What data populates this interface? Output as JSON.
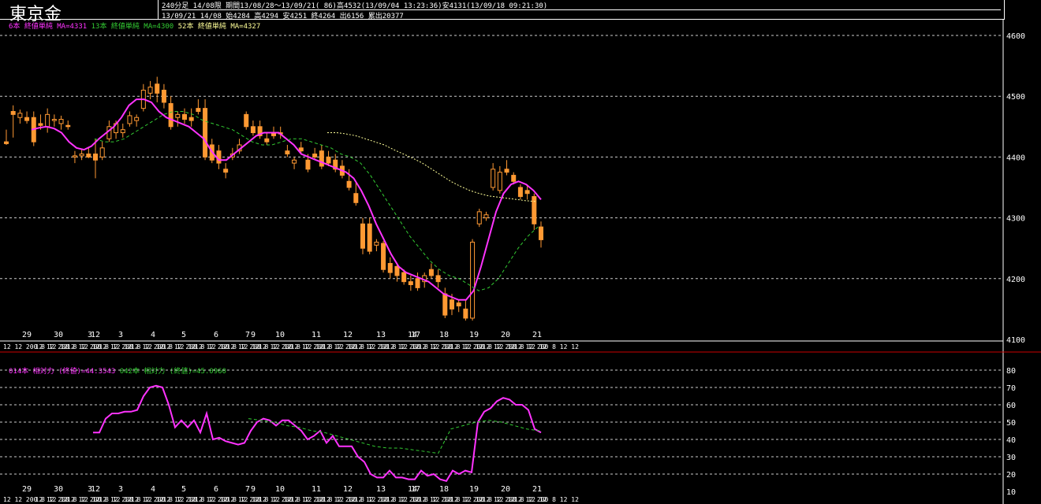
{
  "header": {
    "title": "東京金",
    "line1": "240分足 14/08限 期間13/08/28～13/09/21( 86)高4532(13/09/04 13:23:36)安4131(13/09/18 09:21:30)",
    "line2": "13/09/21 14/08 始4284 高4294 安4251 終4264 出6156 累出20377"
  },
  "legend_main": [
    {
      "text": "6本 終値単純 MA=4331",
      "color": "#ff33ff"
    },
    {
      "text": "13本 終値単純 MA=4300",
      "color": "#33cc33"
    },
    {
      "text": "52本 終値単純 MA=4327",
      "color": "#ffff99"
    }
  ],
  "legend_sub": [
    {
      "text": "014本 相対力 (終値)=44.3543",
      "color": "#ff33ff"
    },
    {
      "text": "042本 相対力 (終値)=45.0960",
      "color": "#33cc33"
    }
  ],
  "colors": {
    "up": "#ff9933",
    "down": "#ff9933",
    "ma6": "#ff33ff",
    "ma13": "#33cc33",
    "ma52": "#ffff99",
    "grid": "#ffffff",
    "separator": "#cc0000"
  },
  "chart_data": [
    {
      "type": "candlestick",
      "title": "東京金",
      "ylim": [
        4100,
        4600
      ],
      "y_ticks": [
        4100,
        4200,
        4300,
        4400,
        4500,
        4600
      ],
      "date_labels": [
        "29",
        "30",
        "3",
        "12",
        "3",
        "4",
        "5",
        "6",
        "7",
        "9",
        "10",
        "11",
        "12",
        "13",
        "14",
        "17",
        "18",
        "19",
        "20",
        "21"
      ],
      "time_label": "12 12 200 8 12 12",
      "candles": [
        {
          "o": 4425,
          "h": 4445,
          "l": 4420,
          "c": 4422
        },
        {
          "o": 4475,
          "h": 4485,
          "l": 4432,
          "c": 4470
        },
        {
          "o": 4465,
          "h": 4478,
          "l": 4455,
          "c": 4472
        },
        {
          "o": 4465,
          "h": 4475,
          "l": 4455,
          "c": 4460
        },
        {
          "o": 4465,
          "h": 4475,
          "l": 4418,
          "c": 4425
        },
        {
          "o": 4455,
          "h": 4470,
          "l": 4445,
          "c": 4452
        },
        {
          "o": 4450,
          "h": 4480,
          "l": 4440,
          "c": 4470
        },
        {
          "o": 4460,
          "h": 4470,
          "l": 4450,
          "c": 4462
        },
        {
          "o": 4455,
          "h": 4468,
          "l": 4445,
          "c": 4462
        },
        {
          "o": 4452,
          "h": 4460,
          "l": 4445,
          "c": 4450
        },
        {
          "o": 4400,
          "h": 4410,
          "l": 4390,
          "c": 4402
        },
        {
          "o": 4402,
          "h": 4412,
          "l": 4395,
          "c": 4405
        },
        {
          "o": 4405,
          "h": 4415,
          "l": 4398,
          "c": 4400
        },
        {
          "o": 4405,
          "h": 4430,
          "l": 4365,
          "c": 4395
        },
        {
          "o": 4400,
          "h": 4425,
          "l": 4395,
          "c": 4415
        },
        {
          "o": 4430,
          "h": 4460,
          "l": 4425,
          "c": 4450
        },
        {
          "o": 4440,
          "h": 4460,
          "l": 4430,
          "c": 4455
        },
        {
          "o": 4440,
          "h": 4455,
          "l": 4432,
          "c": 4445
        },
        {
          "o": 4455,
          "h": 4475,
          "l": 4450,
          "c": 4468
        },
        {
          "o": 4460,
          "h": 4470,
          "l": 4450,
          "c": 4465
        },
        {
          "o": 4480,
          "h": 4520,
          "l": 4475,
          "c": 4510
        },
        {
          "o": 4505,
          "h": 4525,
          "l": 4495,
          "c": 4515
        },
        {
          "o": 4520,
          "h": 4532,
          "l": 4490,
          "c": 4505
        },
        {
          "o": 4510,
          "h": 4520,
          "l": 4480,
          "c": 4490
        },
        {
          "o": 4488,
          "h": 4500,
          "l": 4445,
          "c": 4450
        },
        {
          "o": 4465,
          "h": 4475,
          "l": 4450,
          "c": 4470
        },
        {
          "o": 4470,
          "h": 4480,
          "l": 4455,
          "c": 4462
        },
        {
          "o": 4465,
          "h": 4480,
          "l": 4450,
          "c": 4460
        },
        {
          "o": 4480,
          "h": 4495,
          "l": 4470,
          "c": 4475
        },
        {
          "o": 4480,
          "h": 4495,
          "l": 4395,
          "c": 4400
        },
        {
          "o": 4420,
          "h": 4430,
          "l": 4390,
          "c": 4395
        },
        {
          "o": 4410,
          "h": 4420,
          "l": 4380,
          "c": 4390
        },
        {
          "o": 4380,
          "h": 4390,
          "l": 4365,
          "c": 4375
        },
        {
          "o": 4400,
          "h": 4415,
          "l": 4395,
          "c": 4405
        },
        {
          "o": 4410,
          "h": 4430,
          "l": 4405,
          "c": 4420
        },
        {
          "o": 4470,
          "h": 4475,
          "l": 4445,
          "c": 4450
        },
        {
          "o": 4450,
          "h": 4460,
          "l": 4435,
          "c": 4440
        },
        {
          "o": 4450,
          "h": 4460,
          "l": 4430,
          "c": 4435
        },
        {
          "o": 4430,
          "h": 4440,
          "l": 4420,
          "c": 4425
        },
        {
          "o": 4440,
          "h": 4450,
          "l": 4430,
          "c": 4435
        },
        {
          "o": 4440,
          "h": 4450,
          "l": 4430,
          "c": 4438
        },
        {
          "o": 4410,
          "h": 4420,
          "l": 4400,
          "c": 4405
        },
        {
          "o": 4390,
          "h": 4400,
          "l": 4380,
          "c": 4395
        },
        {
          "o": 4415,
          "h": 4425,
          "l": 4405,
          "c": 4410
        },
        {
          "o": 4395,
          "h": 4405,
          "l": 4375,
          "c": 4380
        },
        {
          "o": 4405,
          "h": 4415,
          "l": 4395,
          "c": 4400
        },
        {
          "o": 4410,
          "h": 4420,
          "l": 4380,
          "c": 4385
        },
        {
          "o": 4400,
          "h": 4410,
          "l": 4385,
          "c": 4390
        },
        {
          "o": 4395,
          "h": 4405,
          "l": 4375,
          "c": 4380
        },
        {
          "o": 4385,
          "h": 4395,
          "l": 4365,
          "c": 4370
        },
        {
          "o": 4360,
          "h": 4380,
          "l": 4345,
          "c": 4350
        },
        {
          "o": 4340,
          "h": 4360,
          "l": 4320,
          "c": 4325
        },
        {
          "o": 4290,
          "h": 4300,
          "l": 4240,
          "c": 4250
        },
        {
          "o": 4290,
          "h": 4300,
          "l": 4240,
          "c": 4245
        },
        {
          "o": 4255,
          "h": 4265,
          "l": 4245,
          "c": 4260
        },
        {
          "o": 4258,
          "h": 4262,
          "l": 4210,
          "c": 4215
        },
        {
          "o": 4225,
          "h": 4235,
          "l": 4200,
          "c": 4210
        },
        {
          "o": 4220,
          "h": 4225,
          "l": 4195,
          "c": 4205
        },
        {
          "o": 4210,
          "h": 4215,
          "l": 4190,
          "c": 4195
        },
        {
          "o": 4195,
          "h": 4205,
          "l": 4180,
          "c": 4190
        },
        {
          "o": 4200,
          "h": 4210,
          "l": 4180,
          "c": 4185
        },
        {
          "o": 4195,
          "h": 4210,
          "l": 4185,
          "c": 4205
        },
        {
          "o": 4215,
          "h": 4225,
          "l": 4200,
          "c": 4205
        },
        {
          "o": 4205,
          "h": 4215,
          "l": 4185,
          "c": 4195
        },
        {
          "o": 4175,
          "h": 4185,
          "l": 4135,
          "c": 4140
        },
        {
          "o": 4165,
          "h": 4175,
          "l": 4140,
          "c": 4150
        },
        {
          "o": 4160,
          "h": 4165,
          "l": 4145,
          "c": 4155
        },
        {
          "o": 4150,
          "h": 4165,
          "l": 4131,
          "c": 4135
        },
        {
          "o": 4135,
          "h": 4265,
          "l": 4131,
          "c": 4260
        },
        {
          "o": 4290,
          "h": 4315,
          "l": 4285,
          "c": 4310
        },
        {
          "o": 4300,
          "h": 4310,
          "l": 4295,
          "c": 4305
        },
        {
          "o": 4350,
          "h": 4390,
          "l": 4345,
          "c": 4380
        },
        {
          "o": 4345,
          "h": 4385,
          "l": 4340,
          "c": 4375
        },
        {
          "o": 4380,
          "h": 4395,
          "l": 4370,
          "c": 4375
        },
        {
          "o": 4370,
          "h": 4375,
          "l": 4355,
          "c": 4360
        },
        {
          "o": 4350,
          "h": 4355,
          "l": 4330,
          "c": 4335
        },
        {
          "o": 4345,
          "h": 4355,
          "l": 4330,
          "c": 4340
        },
        {
          "o": 4335,
          "h": 4340,
          "l": 4280,
          "c": 4290
        },
        {
          "o": 4285,
          "h": 4294,
          "l": 4251,
          "c": 4264
        }
      ],
      "ma6": [
        4445,
        4448,
        4450,
        4447,
        4440,
        4425,
        4415,
        4412,
        4418,
        4430,
        4440,
        4450,
        4465,
        4485,
        4495,
        4495,
        4490,
        4475,
        4465,
        4460,
        4455,
        4450,
        4440,
        4430,
        4410,
        4395,
        4395,
        4405,
        4415,
        4425,
        4435,
        4440,
        4440,
        4440,
        4430,
        4420,
        4405,
        4400,
        4395,
        4390,
        4385,
        4380,
        4375,
        4365,
        4345,
        4320,
        4290,
        4265,
        4240,
        4220,
        4210,
        4205,
        4200,
        4195,
        4185,
        4175,
        4170,
        4165,
        4165,
        4180,
        4220,
        4265,
        4310,
        4340,
        4355,
        4360,
        4355,
        4345,
        4330
      ],
      "ma13": [
        4430,
        4425,
        4425,
        4430,
        4440,
        4450,
        4460,
        4470,
        4475,
        4475,
        4470,
        4460,
        4455,
        4450,
        4445,
        4435,
        4425,
        4420,
        4420,
        4425,
        4430,
        4430,
        4425,
        4420,
        4415,
        4405,
        4400,
        4390,
        4370,
        4345,
        4320,
        4295,
        4270,
        4250,
        4230,
        4215,
        4205,
        4200,
        4190,
        4180,
        4185,
        4200,
        4225,
        4250,
        4270,
        4285
      ],
      "ma52": [
        4440,
        4440,
        4438,
        4435,
        4430,
        4425,
        4420,
        4412,
        4405,
        4398,
        4390,
        4380,
        4370,
        4360,
        4352,
        4345,
        4340,
        4336,
        4334,
        4332,
        4330,
        4328,
        4327
      ]
    },
    {
      "type": "line",
      "title": "相対力",
      "ylim": [
        10,
        80
      ],
      "y_ticks": [
        10,
        20,
        30,
        40,
        50,
        60,
        70,
        80
      ],
      "rsi14": [
        44,
        44,
        52,
        55,
        55,
        56,
        56,
        57,
        65,
        70,
        71,
        70,
        60,
        47,
        51,
        47,
        51,
        44,
        55,
        40,
        41,
        39,
        38,
        37,
        38,
        45,
        50,
        52,
        51,
        48,
        51,
        51,
        48,
        45,
        40,
        42,
        45,
        38,
        42,
        36,
        36,
        36,
        30,
        27,
        20,
        18,
        18,
        22,
        18,
        18,
        17,
        17,
        22,
        19,
        20,
        17,
        16,
        22,
        20,
        22,
        21,
        50,
        56,
        58,
        62,
        64,
        63,
        60,
        60,
        57,
        46,
        44
      ],
      "rsi42": [
        52,
        51,
        50,
        48,
        47,
        45,
        44,
        42,
        40,
        38,
        36,
        35,
        35,
        34,
        33,
        32,
        46,
        48,
        50,
        51,
        50,
        48,
        46,
        45
      ]
    }
  ]
}
